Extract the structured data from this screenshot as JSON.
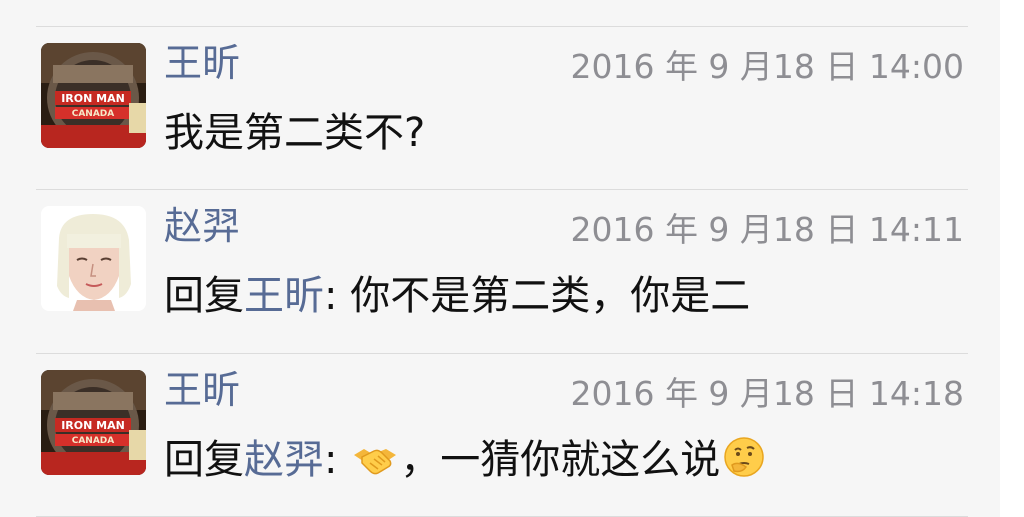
{
  "comments": [
    {
      "author": "王昕",
      "avatar": "ironman-canada-avatar",
      "timestamp": "2016 年 9 月18 日 14:00",
      "text": "我是第二类不?"
    },
    {
      "author": "赵羿",
      "avatar": "illustrated-portrait-avatar",
      "timestamp": "2016 年 9 月18 日 14:11",
      "reply_prefix": "回复",
      "reply_to": "王昕",
      "reply_separator": ": ",
      "text": "你不是第二类，你是二"
    },
    {
      "author": "王昕",
      "avatar": "ironman-canada-avatar",
      "timestamp": "2016 年 9 月18 日 14:18",
      "reply_prefix": "回复",
      "reply_to": "赵羿",
      "reply_separator": ": ",
      "emoji_before": "handshake-emoji",
      "text": "，一猜你就这么说",
      "emoji_after": "thinking-face-emoji"
    }
  ],
  "colors": {
    "name": "#576b95",
    "timestamp": "#8e8e93",
    "text": "#111111",
    "background": "#f6f6f6",
    "divider": "#dcdcdc"
  }
}
